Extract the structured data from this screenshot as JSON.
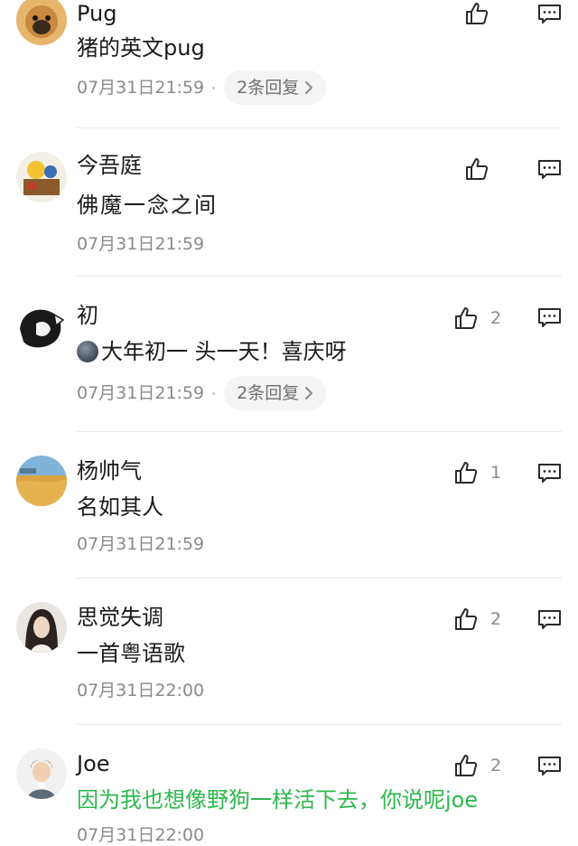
{
  "comments": [
    {
      "name": "Pug",
      "text": "猪的英文pug",
      "time": "07月31日21:59",
      "replies": "2条回复",
      "likes": ""
    },
    {
      "name": "今吾庭",
      "text": "佛魔一念之间",
      "time": "07月31日21:59",
      "replies": "",
      "likes": ""
    },
    {
      "name": "初",
      "text": "大年初一 头一天！喜庆呀",
      "time": "07月31日21:59",
      "replies": "2条回复",
      "likes": "2"
    },
    {
      "name": "杨帅气",
      "text": "名如其人",
      "time": "07月31日21:59",
      "replies": "",
      "likes": "1"
    },
    {
      "name": "思觉失调",
      "text": "一首粤语歌",
      "time": "07月31日22:00",
      "replies": "",
      "likes": "2"
    },
    {
      "name": "Joe",
      "text": "因为我也想像野狗一样活下去，你说呢joe",
      "time": "07月31日22:00",
      "replies": "",
      "likes": "2"
    }
  ],
  "colors": {
    "accent_green": "#2db84d",
    "meta_gray": "#8a8a8a",
    "divider": "#e9e9e9"
  },
  "icons": {
    "like": "thumbs-up-icon",
    "reply": "comment-bubble-icon",
    "chevron": "chevron-right-icon",
    "emoji": "moon-emoji-icon"
  }
}
